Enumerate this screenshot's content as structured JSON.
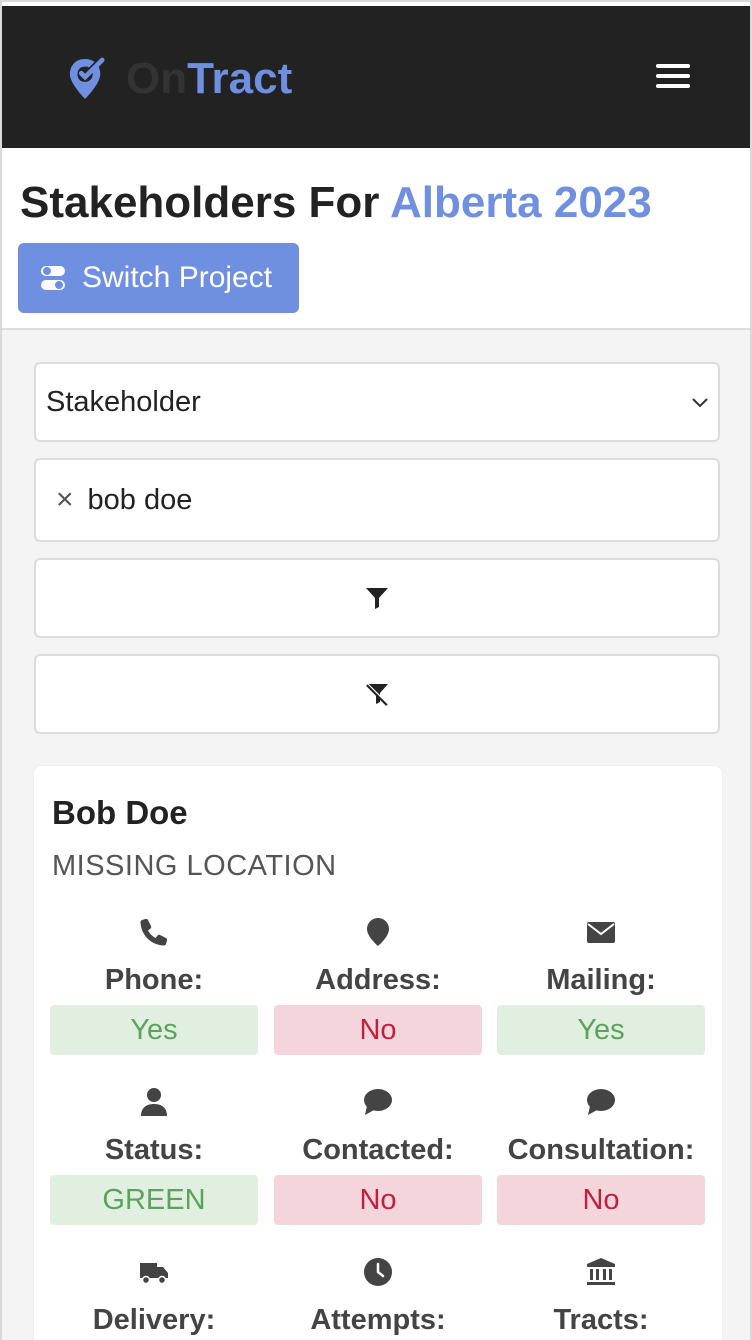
{
  "app": {
    "brand_prefix": "On",
    "brand_suffix": "Tract",
    "accent": "#6f8fe0",
    "nav_bg": "#222222"
  },
  "header": {
    "title_prefix": "Stakeholders For",
    "project_name": "Alberta 2023",
    "switch_label": "Switch Project"
  },
  "filters": {
    "type_selected": "Stakeholder",
    "search_value": "bob doe",
    "filter_icon": "filter-icon",
    "clear_filter_icon": "filter-slash-icon"
  },
  "card": {
    "name": "Bob Doe",
    "subtitle": "MISSING LOCATION",
    "fields": [
      {
        "icon": "phone-icon",
        "label": "Phone:",
        "value": "Yes",
        "state": "yes"
      },
      {
        "icon": "map-marker-icon",
        "label": "Address:",
        "value": "No",
        "state": "no"
      },
      {
        "icon": "envelope-icon",
        "label": "Mailing:",
        "value": "Yes",
        "state": "yes"
      },
      {
        "icon": "user-icon",
        "label": "Status:",
        "value": "GREEN",
        "state": "yes"
      },
      {
        "icon": "comment-icon",
        "label": "Contacted:",
        "value": "No",
        "state": "no"
      },
      {
        "icon": "comment-icon",
        "label": "Consultation:",
        "value": "No",
        "state": "no"
      },
      {
        "icon": "truck-icon",
        "label": "Delivery:"
      },
      {
        "icon": "clock-icon",
        "label": "Attempts:"
      },
      {
        "icon": "bank-icon",
        "label": "Tracts:"
      }
    ]
  }
}
